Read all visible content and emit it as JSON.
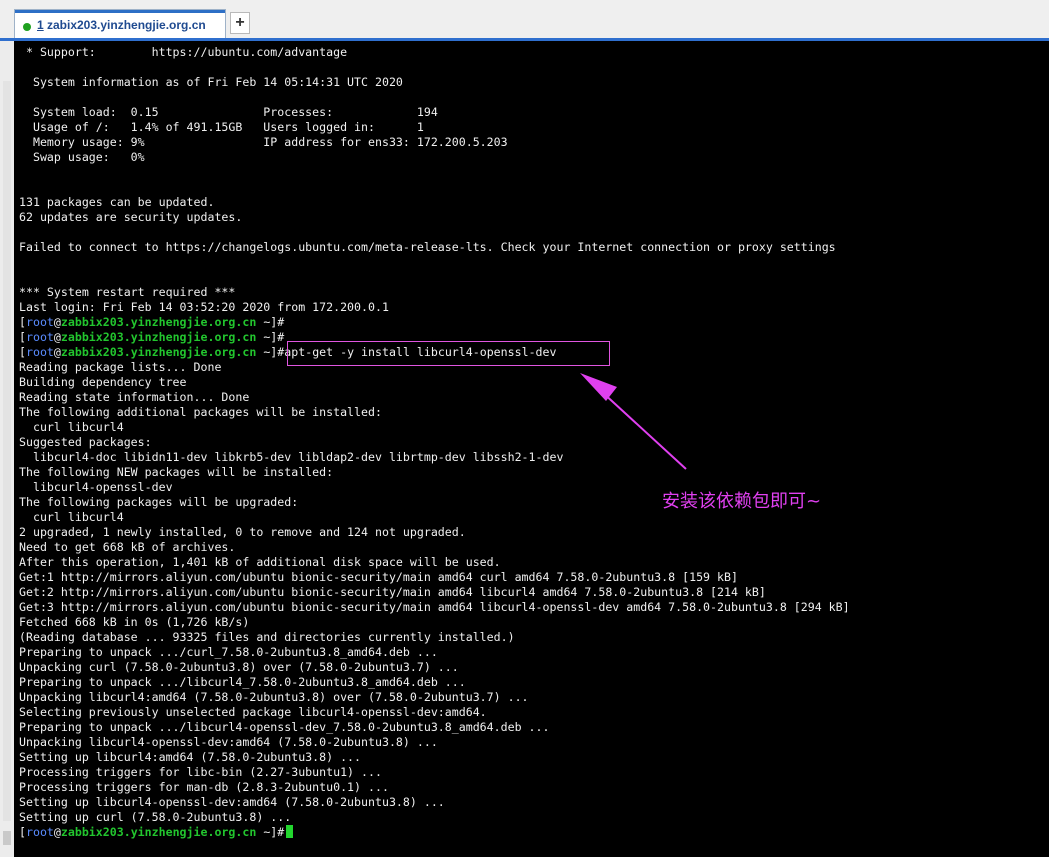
{
  "tabs": {
    "active": {
      "number": "1",
      "label": " zabix203.yinzhengjie.org.cn"
    },
    "add_icon": "plus-icon",
    "add_label": "+"
  },
  "colors": {
    "prompt_user": "#5a8cff",
    "prompt_host": "#22c52e",
    "annotation": "#e040f0",
    "tab_accent": "#2f6fce"
  },
  "prompt": {
    "open": "[",
    "user": "root",
    "at": "@",
    "host": "zabbix203.yinzhengjie.org.cn",
    "path": " ~]",
    "sign": "#"
  },
  "terminal": {
    "lines_top": [
      " * Support:        https://ubuntu.com/advantage",
      "",
      "  System information as of Fri Feb 14 05:14:31 UTC 2020",
      "",
      "  System load:  0.15               Processes:            194",
      "  Usage of /:   1.4% of 491.15GB   Users logged in:      1",
      "  Memory usage: 9%                 IP address for ens33: 172.200.5.203",
      "  Swap usage:   0%",
      "",
      "",
      "131 packages can be updated.",
      "62 updates are security updates.",
      "",
      "Failed to connect to https://changelogs.ubuntu.com/meta-release-lts. Check your Internet connection or proxy settings",
      "",
      "",
      "*** System restart required ***",
      "Last login: Fri Feb 14 03:52:20 2020 from 172.200.0.1"
    ],
    "command": "apt-get -y install libcurl4-openssl-dev",
    "output": [
      "Reading package lists... Done",
      "Building dependency tree",
      "Reading state information... Done",
      "The following additional packages will be installed:",
      "  curl libcurl4",
      "Suggested packages:",
      "  libcurl4-doc libidn11-dev libkrb5-dev libldap2-dev librtmp-dev libssh2-1-dev",
      "The following NEW packages will be installed:",
      "  libcurl4-openssl-dev",
      "The following packages will be upgraded:",
      "  curl libcurl4",
      "2 upgraded, 1 newly installed, 0 to remove and 124 not upgraded.",
      "Need to get 668 kB of archives.",
      "After this operation, 1,401 kB of additional disk space will be used.",
      "Get:1 http://mirrors.aliyun.com/ubuntu bionic-security/main amd64 curl amd64 7.58.0-2ubuntu3.8 [159 kB]",
      "Get:2 http://mirrors.aliyun.com/ubuntu bionic-security/main amd64 libcurl4 amd64 7.58.0-2ubuntu3.8 [214 kB]",
      "Get:3 http://mirrors.aliyun.com/ubuntu bionic-security/main amd64 libcurl4-openssl-dev amd64 7.58.0-2ubuntu3.8 [294 kB]",
      "Fetched 668 kB in 0s (1,726 kB/s)",
      "(Reading database ... 93325 files and directories currently installed.)",
      "Preparing to unpack .../curl_7.58.0-2ubuntu3.8_amd64.deb ...",
      "Unpacking curl (7.58.0-2ubuntu3.8) over (7.58.0-2ubuntu3.7) ...",
      "Preparing to unpack .../libcurl4_7.58.0-2ubuntu3.8_amd64.deb ...",
      "Unpacking libcurl4:amd64 (7.58.0-2ubuntu3.8) over (7.58.0-2ubuntu3.7) ...",
      "Selecting previously unselected package libcurl4-openssl-dev:amd64.",
      "Preparing to unpack .../libcurl4-openssl-dev_7.58.0-2ubuntu3.8_amd64.deb ...",
      "Unpacking libcurl4-openssl-dev:amd64 (7.58.0-2ubuntu3.8) ...",
      "Setting up libcurl4:amd64 (7.58.0-2ubuntu3.8) ...",
      "Processing triggers for libc-bin (2.27-3ubuntu1) ...",
      "Processing triggers for man-db (2.8.3-2ubuntu0.1) ...",
      "Setting up libcurl4-openssl-dev:amd64 (7.58.0-2ubuntu3.8) ...",
      "Setting up curl (7.58.0-2ubuntu3.8) ..."
    ]
  },
  "annotation": {
    "text": "安装该依赖包即可~",
    "arrow_icon": "arrow-icon"
  }
}
